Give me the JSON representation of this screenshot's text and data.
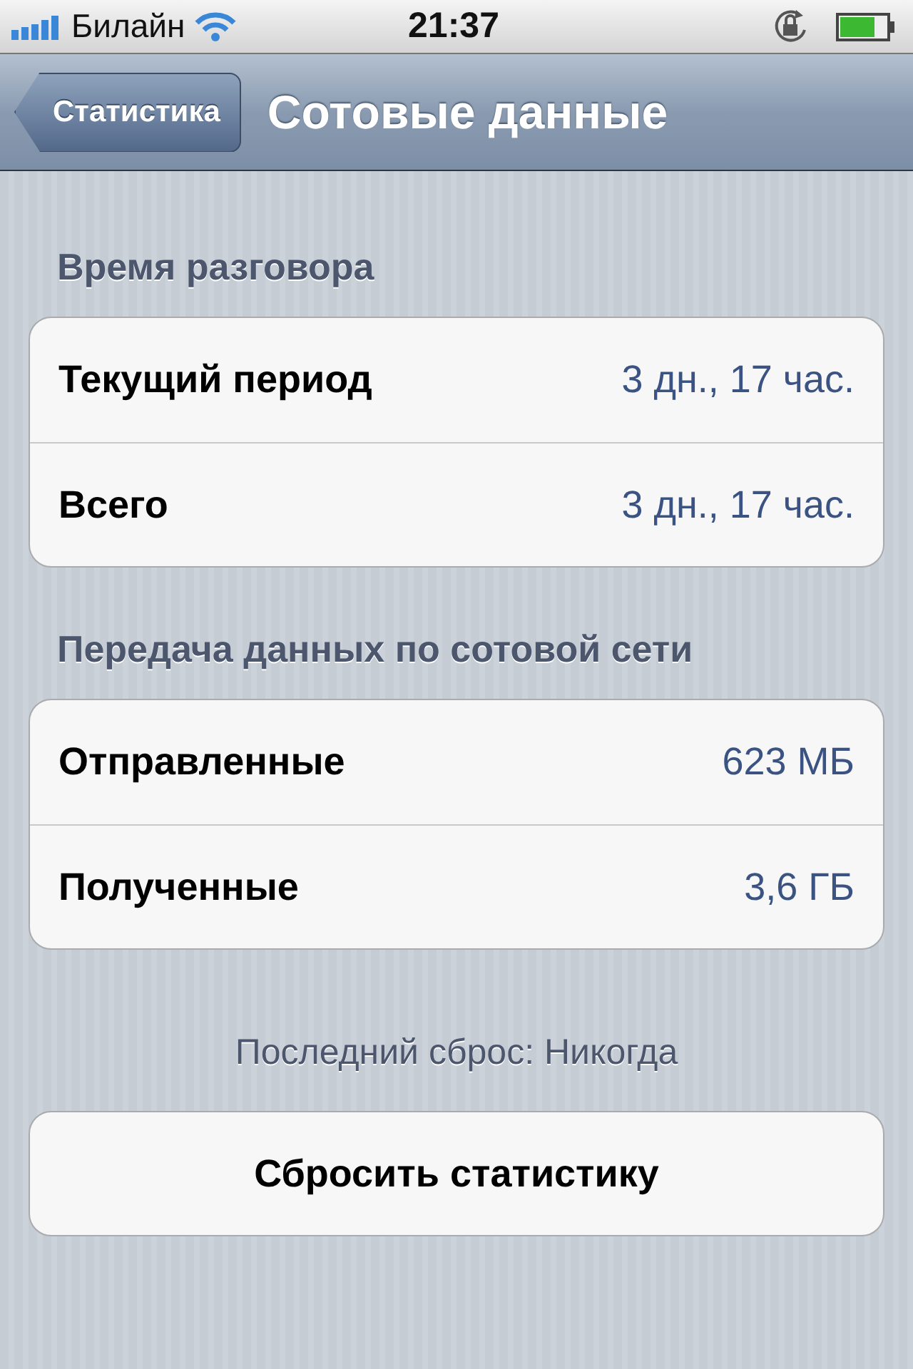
{
  "status_bar": {
    "carrier": "Билайн",
    "time": "21:37"
  },
  "nav_bar": {
    "back": "Статистика",
    "title": "Сотовые данные"
  },
  "sections": [
    {
      "header": "Время разговора",
      "rows": [
        {
          "label": "Текущий период",
          "value": "3 дн., 17 час."
        },
        {
          "label": "Всего",
          "value": "3 дн., 17 час."
        }
      ]
    },
    {
      "header": "Передача данных по сотовой сети",
      "rows": [
        {
          "label": "Отправленные",
          "value": "623 МБ"
        },
        {
          "label": "Полученные",
          "value": "3,6 ГБ"
        }
      ]
    }
  ],
  "footer": "Последний сброс: Никогда",
  "reset_button": "Сбросить статистику"
}
